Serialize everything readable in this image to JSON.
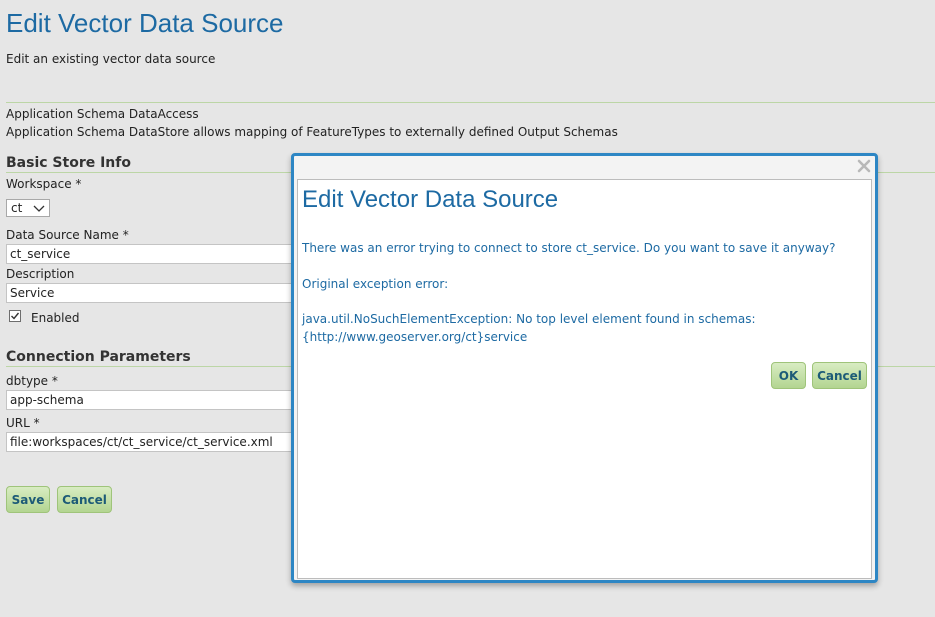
{
  "header": {
    "title": "Edit Vector Data Source",
    "subtitle": "Edit an existing vector data source"
  },
  "store": {
    "type": "Application Schema DataAccess",
    "description": "Application Schema DataStore allows mapping of FeatureTypes to externally defined Output Schemas"
  },
  "basic_info": {
    "title": "Basic Store Info",
    "workspace_label": "Workspace *",
    "workspace_value": "ct",
    "name_label": "Data Source Name *",
    "name_value": "ct_service",
    "description_label": "Description",
    "description_value": "Service",
    "enabled_label": "Enabled",
    "enabled_checked": true
  },
  "connection": {
    "title": "Connection Parameters",
    "dbtype_label": "dbtype *",
    "dbtype_value": "app-schema",
    "url_label": "URL *",
    "url_value": "file:workspaces/ct/ct_service/ct_service.xml"
  },
  "actions": {
    "save_label": "Save",
    "cancel_label": "Cancel"
  },
  "dialog": {
    "close_icon": "close-icon",
    "title": "Edit Vector Data Source",
    "message": "There was an error trying to connect to store ct_service. Do you want to save it anyway?",
    "exception_label": "Original exception error:",
    "exception_text": "java.util.NoSuchElementException: No top level element found in schemas: {http://www.geoserver.org/ct}service",
    "ok_label": "OK",
    "cancel_label": "Cancel"
  },
  "colors": {
    "title": "#1d6aa3",
    "button_fill": "#b3d591",
    "button_text": "#1d5b77",
    "dialog_border": "#2d86c4"
  }
}
